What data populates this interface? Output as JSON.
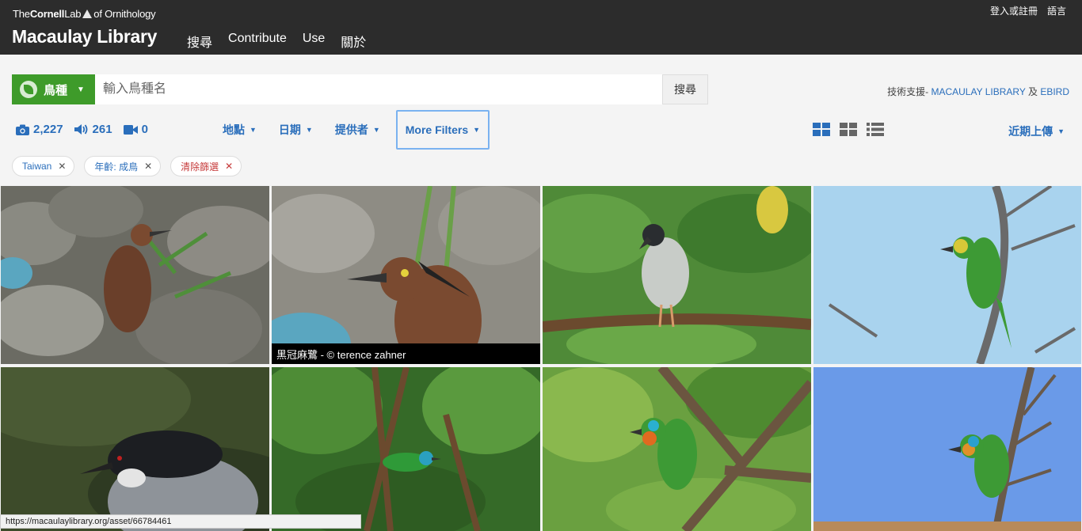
{
  "header": {
    "lab_prefix": "The",
    "lab_name": "Cornell",
    "lab_suffix": "Lab",
    "lab_of": "of Ornithology",
    "brand": "Macaulay Library",
    "nav": [
      "搜尋",
      "Contribute",
      "Use",
      "關於"
    ],
    "login": "登入或註冊",
    "language": "語言"
  },
  "search": {
    "species_label": "鳥種",
    "placeholder": "輸入鳥種名",
    "button": "搜尋",
    "powered_prefix": "技術支援- ",
    "powered_link1": "MACAULAY LIBRARY",
    "powered_and": " 及 ",
    "powered_link2": "EBIRD"
  },
  "counts": {
    "photos": "2,227",
    "audio": "261",
    "video": "0"
  },
  "filters": {
    "location": "地點",
    "date": "日期",
    "contributor": "提供者",
    "more": "More Filters",
    "sort": "近期上傳"
  },
  "chips": [
    {
      "label": "Taiwan",
      "type": "normal"
    },
    {
      "label": "年齡: 成鳥",
      "type": "normal"
    },
    {
      "label": "清除篩選",
      "type": "clear"
    }
  ],
  "hover_caption": "黑冠麻鷺 - © terence zahner",
  "status_url": "https://macaulaylibrary.org/asset/66784461",
  "colors": {
    "header_bg": "#2c2c2c",
    "accent_green": "#3e9b2a",
    "link_blue": "#2a6ebb",
    "clear_red": "#c63a3a"
  },
  "icons": {
    "photos": "camera-icon",
    "audio": "speaker-icon",
    "video": "video-camera-icon",
    "view_large": "large-grid-icon",
    "view_small": "small-grid-icon",
    "view_list": "list-icon"
  }
}
